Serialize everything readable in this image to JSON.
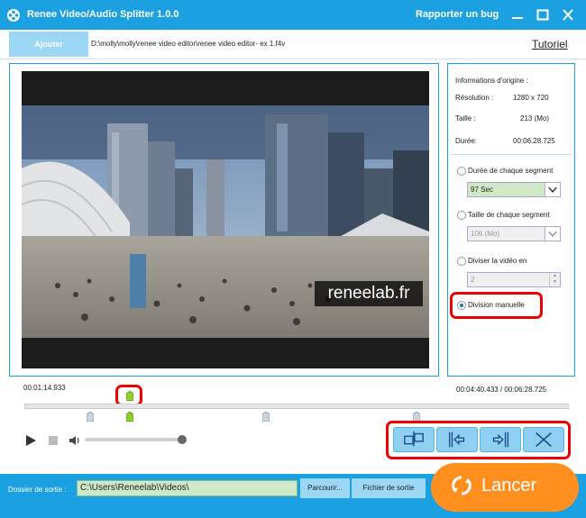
{
  "app": {
    "title": "Renee Video/Audio Splitter 1.0.0",
    "report_bug": "Rapporter un bug",
    "accent": "#1ba1e2"
  },
  "toolbar": {
    "add_label": "Ajouter",
    "file_path": "D:\\molly\\molly\\renee video editor\\renee video editor- ex 1.f4v",
    "tutorial": "Tutoriel"
  },
  "video": {
    "watermark": "reneelab.fr"
  },
  "info": {
    "heading": "Informations d'origine :",
    "resolution_label": "Résolution :",
    "resolution_value": "1280 x 720",
    "size_label": "Taille :",
    "size_value": "213 (Mo)",
    "duration_label": "Durée:",
    "duration_value": "00:06:28.725"
  },
  "split_options": {
    "segment_duration_label": "Durée de chaque segment",
    "segment_duration_value": "97 Sec",
    "segment_size_label": "Taille de chaque segment",
    "segment_size_value": "106 (Mo)",
    "divide_label": "Diviser la vidéo en",
    "divide_value": "2",
    "manual_label": "Division manuelle",
    "selected": "manual"
  },
  "playback": {
    "current_time": "00:01:14.933",
    "range_time": "00:04:40.433 / 00:06:28.725",
    "position": 0.19,
    "volume": 1.0,
    "markers": [
      0.12,
      0.19,
      0.45,
      0.72
    ]
  },
  "output": {
    "folder_label": "Dossier de sortie :",
    "folder_value": "C:\\Users\\Reneelab\\Videos\\",
    "browse_label": "Parcourir...",
    "open_label": "Fichier de sortie",
    "start_label": "Lancer"
  },
  "colors": {
    "highlight": "#e00000",
    "start_button": "#ff8f1f",
    "field_green": "#cfe9c7"
  }
}
